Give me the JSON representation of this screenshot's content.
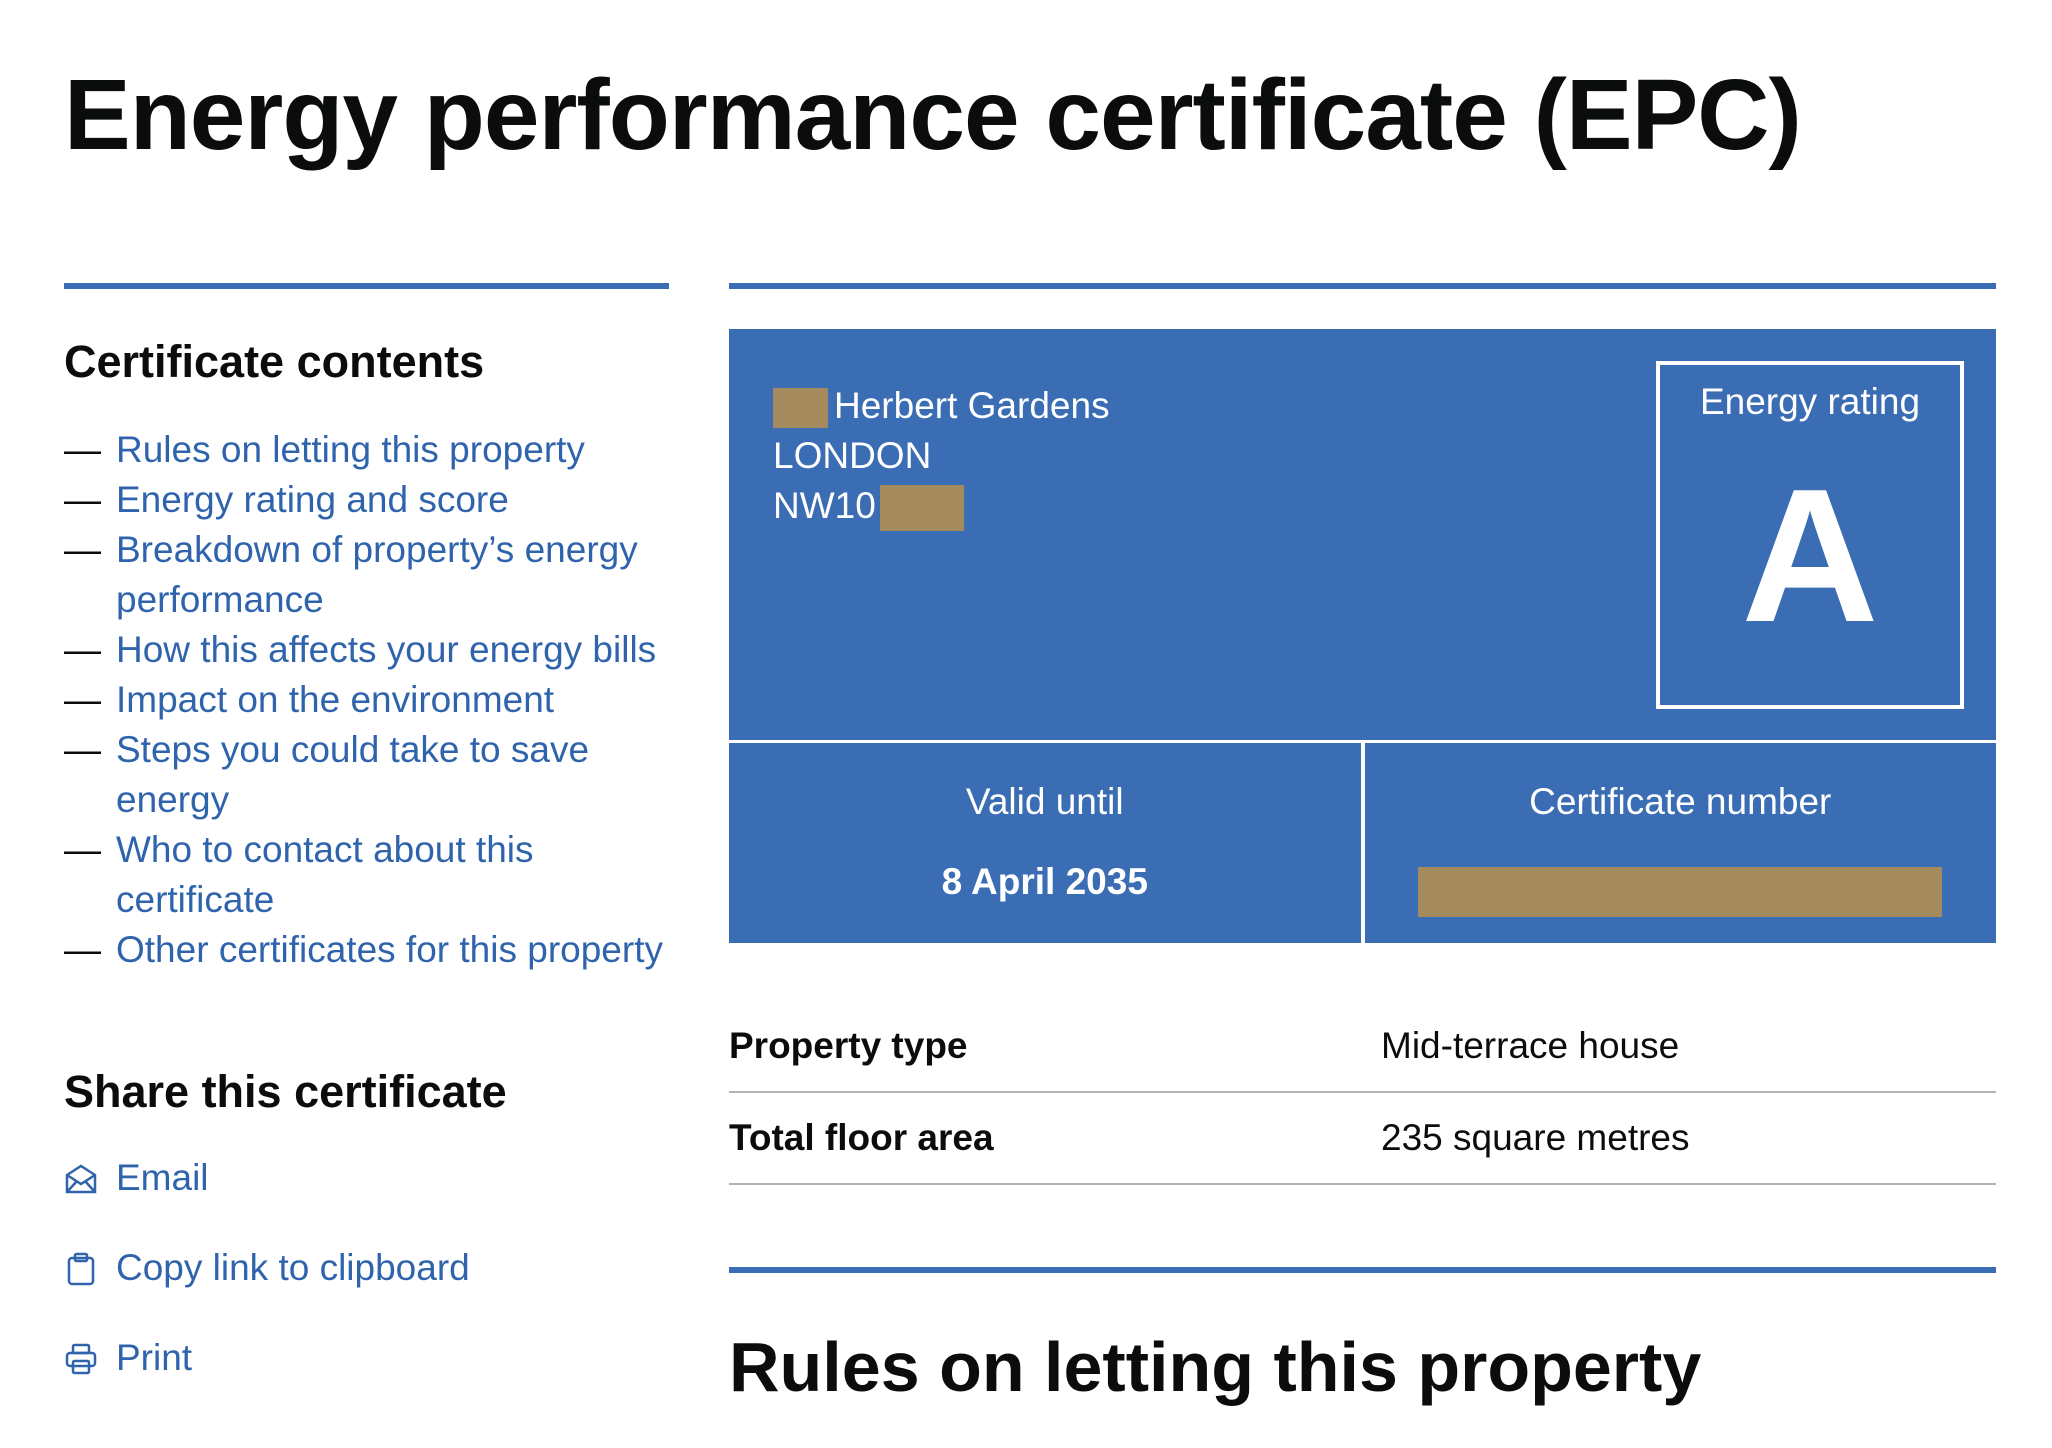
{
  "page": {
    "title": "Energy performance certificate (EPC)"
  },
  "sidebar": {
    "contents_heading": "Certificate contents",
    "contents": [
      {
        "label": "Rules on letting this property"
      },
      {
        "label": "Energy rating and score"
      },
      {
        "label": "Breakdown of property’s energy performance"
      },
      {
        "label": "How this affects your energy bills"
      },
      {
        "label": "Impact on the environment"
      },
      {
        "label": "Steps you could take to save energy"
      },
      {
        "label": "Who to contact about this certificate"
      },
      {
        "label": "Other certificates for this property"
      }
    ],
    "share_heading": "Share this certificate",
    "share": [
      {
        "label": "Email",
        "icon": "email-icon"
      },
      {
        "label": "Copy link to clipboard",
        "icon": "clipboard-icon"
      },
      {
        "label": "Print",
        "icon": "printer-icon"
      }
    ]
  },
  "certificate": {
    "address_line1": "Herbert Gardens",
    "address_line2": "LONDON",
    "address_line3": "NW10",
    "rating_label": "Energy rating",
    "rating": "A",
    "valid_until_label": "Valid until",
    "valid_until": "8 April 2035",
    "certificate_number_label": "Certificate number"
  },
  "summary": [
    {
      "key": "Property type",
      "value": "Mid-terrace house"
    },
    {
      "key": "Total floor area",
      "value": "235 square metres"
    }
  ],
  "section": {
    "heading": "Rules on letting this property"
  },
  "colors": {
    "brand_blue": "#3a6db4",
    "link_blue": "#2f64ad",
    "redaction": "#a48a5d"
  }
}
